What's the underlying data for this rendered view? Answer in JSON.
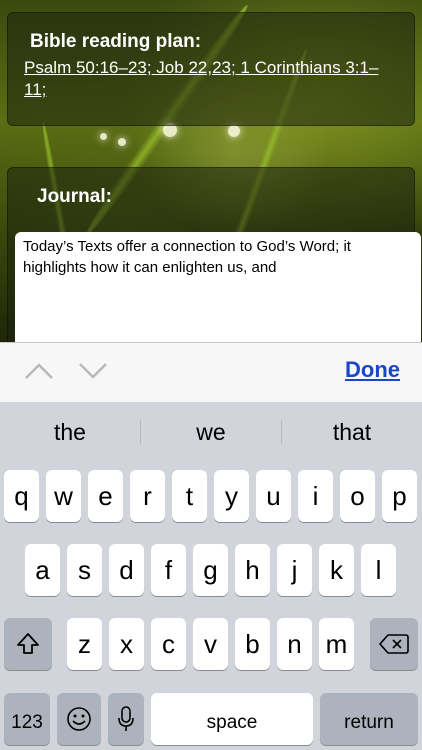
{
  "reading_plan": {
    "title": "Bible reading plan:",
    "passages": "Psalm 50:16–23; Job 22,23; 1 Corinthians 3:1–11;"
  },
  "journal": {
    "title": "Journal:",
    "text": "Today’s Texts offer a connection to God’s Word; it highlights how it can enlighten us, and"
  },
  "accessory_bar": {
    "done_label": "Done",
    "prev_icon": "chevron-up-icon",
    "next_icon": "chevron-down-icon"
  },
  "keyboard": {
    "suggestions": [
      "the",
      "we",
      "that"
    ],
    "row1": [
      "q",
      "w",
      "e",
      "r",
      "t",
      "y",
      "u",
      "i",
      "o",
      "p"
    ],
    "row2": [
      "a",
      "s",
      "d",
      "f",
      "g",
      "h",
      "j",
      "k",
      "l"
    ],
    "row3": [
      "z",
      "x",
      "c",
      "v",
      "b",
      "n",
      "m"
    ],
    "numbers_label": "123",
    "space_label": "space",
    "return_label": "return",
    "icons": {
      "shift": "shift-icon",
      "delete": "backspace-icon",
      "emoji": "emoji-icon",
      "dictation": "microphone-icon"
    }
  }
}
